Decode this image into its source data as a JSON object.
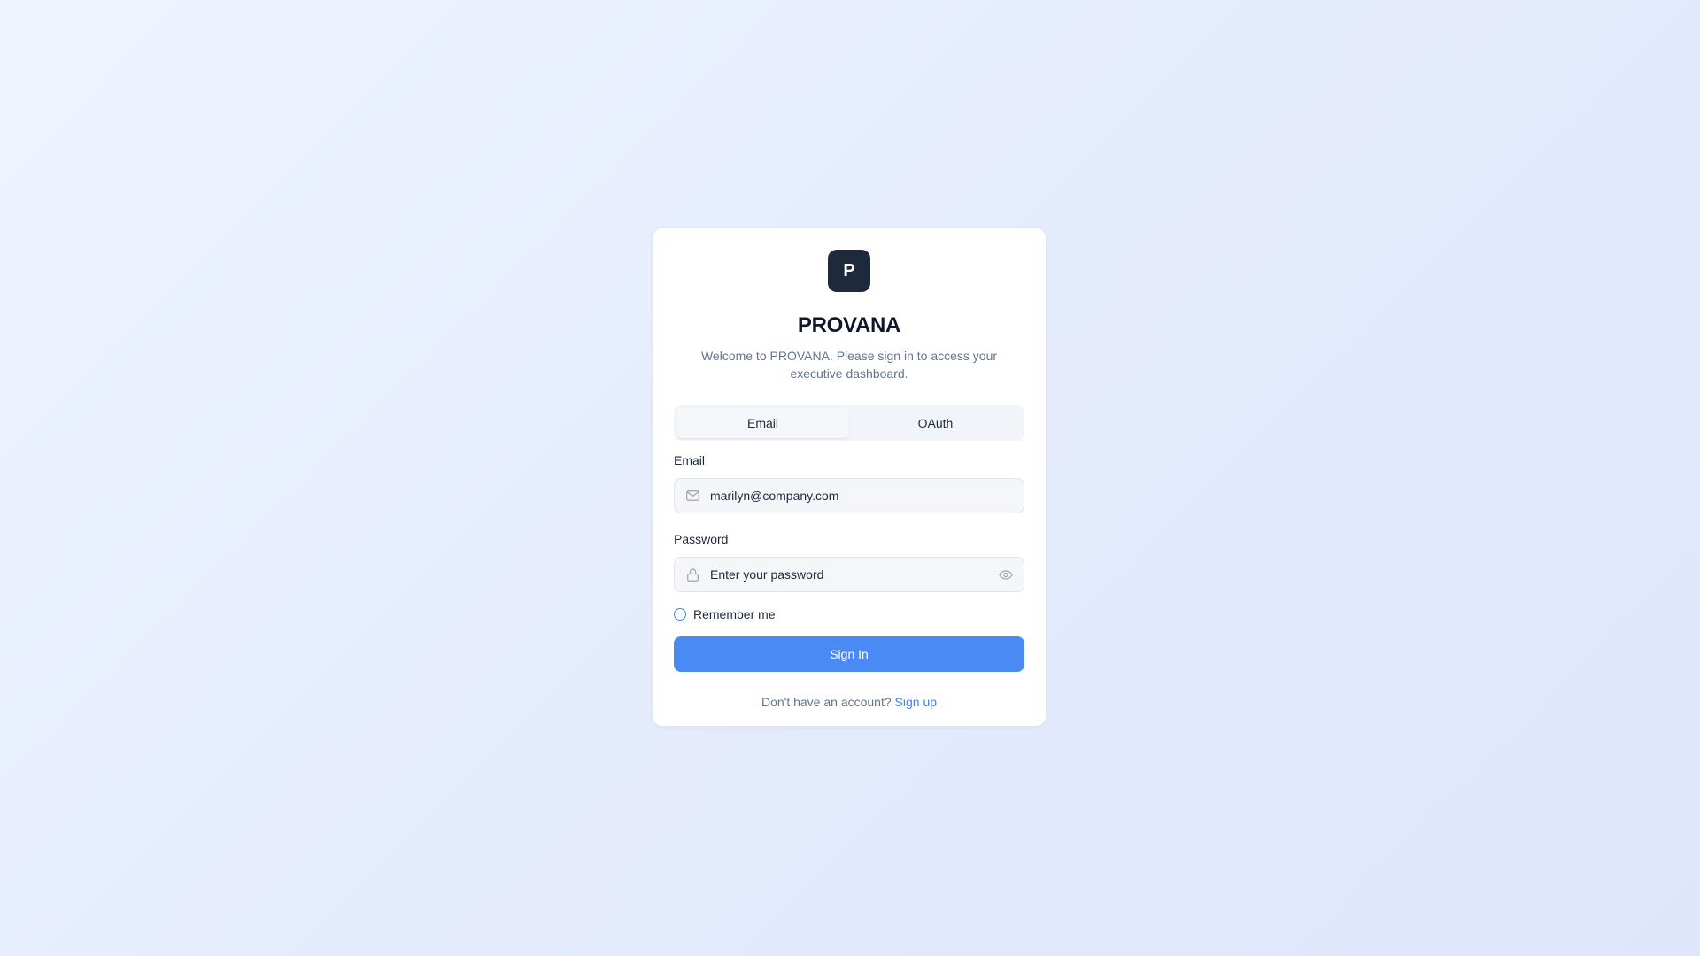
{
  "brand": {
    "logo_letter": "P",
    "name": "PROVANA",
    "welcome": "Welcome to PROVANA. Please sign in to access your executive dashboard."
  },
  "tabs": [
    {
      "label": "Email",
      "active": true
    },
    {
      "label": "OAuth",
      "active": false
    }
  ],
  "form": {
    "email_label": "Email",
    "email_value": "marilyn@company.com",
    "password_label": "Password",
    "password_placeholder": "Enter your password",
    "remember_label": "Remember me",
    "remember_checked": false,
    "submit_label": "Sign In"
  },
  "footer": {
    "prompt": "Don't have an account?",
    "link_label": "Sign up"
  },
  "icons": {
    "email": "mail-icon",
    "password": "lock-icon",
    "toggle_password": "eye-icon"
  },
  "colors": {
    "accent": "#4a8af5",
    "logo_bg": "#1e293b",
    "link": "#3b82f6"
  }
}
